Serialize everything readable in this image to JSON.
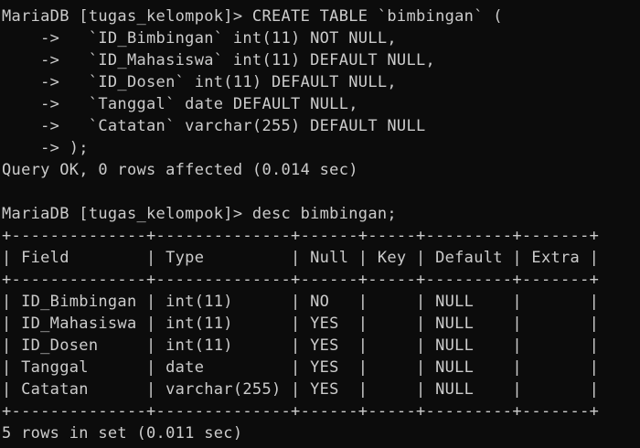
{
  "terminal": {
    "lines": [
      "MariaDB [tugas_kelompok]> CREATE TABLE `bimbingan` (",
      "    ->   `ID_Bimbingan` int(11) NOT NULL,",
      "    ->   `ID_Mahasiswa` int(11) DEFAULT NULL,",
      "    ->   `ID_Dosen` int(11) DEFAULT NULL,",
      "    ->   `Tanggal` date DEFAULT NULL,",
      "    ->   `Catatan` varchar(255) DEFAULT NULL",
      "    -> );",
      "Query OK, 0 rows affected (0.014 sec)",
      "",
      "MariaDB [tugas_kelompok]> desc bimbingan;",
      "+--------------+--------------+------+-----+---------+-------+",
      "| Field        | Type         | Null | Key | Default | Extra |",
      "+--------------+--------------+------+-----+---------+-------+",
      "| ID_Bimbingan | int(11)      | NO   |     | NULL    |       |",
      "| ID_Mahasiswa | int(11)      | YES  |     | NULL    |       |",
      "| ID_Dosen     | int(11)      | YES  |     | NULL    |       |",
      "| Tanggal      | date         | YES  |     | NULL    |       |",
      "| Catatan      | varchar(255) | YES  |     | NULL    |       |",
      "+--------------+--------------+------+-----+---------+-------+",
      "5 rows in set (0.011 sec)"
    ]
  }
}
